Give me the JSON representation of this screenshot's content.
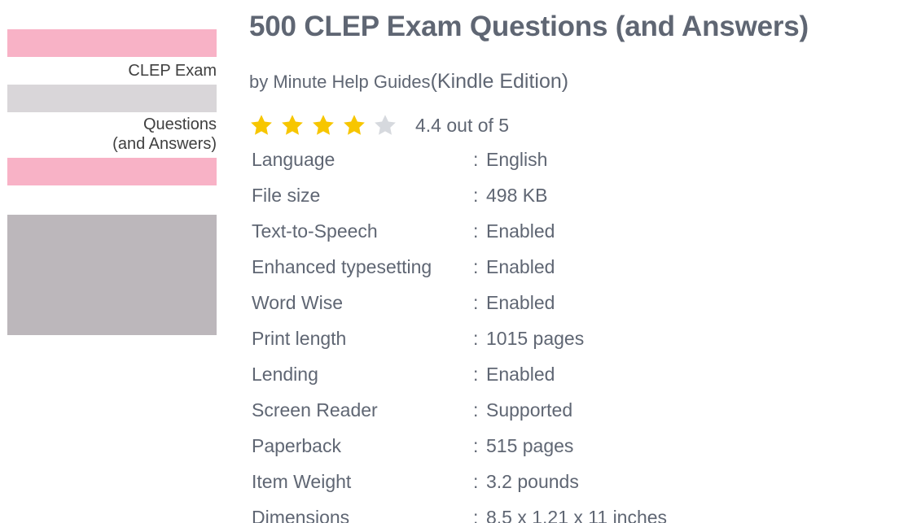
{
  "cover": {
    "title_line_1": "CLEP Exam",
    "title_line_2": "Questions",
    "title_line_3": "(and Answers)",
    "colors": {
      "pink": "#f8b2c6",
      "light_grey": "#d9d6d9",
      "grey": "#bcb7bb"
    }
  },
  "book": {
    "title": "500 CLEP Exam Questions (and Answers)",
    "byline_author": "by Minute Help Guides",
    "byline_edition": "(Kindle Edition)"
  },
  "rating": {
    "value": 4.4,
    "max": 5,
    "text": "4.4 out of 5",
    "star_color": "#f7c600",
    "empty_star_color": "#d6d9de"
  },
  "details": {
    "separator": ":",
    "rows": [
      {
        "label": "Language",
        "value": "English"
      },
      {
        "label": "File size",
        "value": "498 KB"
      },
      {
        "label": "Text-to-Speech",
        "value": "Enabled"
      },
      {
        "label": "Enhanced typesetting",
        "value": "Enabled"
      },
      {
        "label": "Word Wise",
        "value": "Enabled"
      },
      {
        "label": "Print length",
        "value": "1015 pages"
      },
      {
        "label": "Lending",
        "value": "Enabled"
      },
      {
        "label": "Screen Reader",
        "value": "Supported"
      },
      {
        "label": "Paperback",
        "value": "515 pages"
      },
      {
        "label": "Item Weight",
        "value": "3.2 pounds"
      },
      {
        "label": "Dimensions",
        "value": "8.5 x 1.21 x 11 inches"
      }
    ]
  }
}
